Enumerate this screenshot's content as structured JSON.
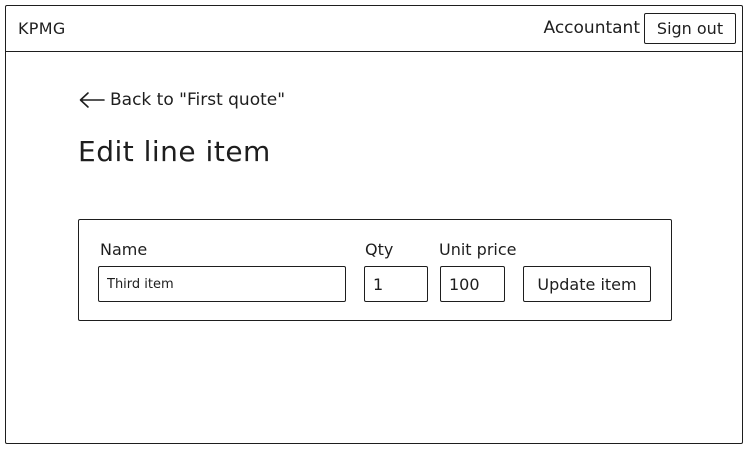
{
  "header": {
    "brand": "KPMG",
    "user_name": "Accountant",
    "sign_out_label": "Sign out"
  },
  "nav": {
    "back_label": "Back to \"First quote\"",
    "back_icon": "arrow-left-icon"
  },
  "page": {
    "title": "Edit line item"
  },
  "form": {
    "name_label": "Name",
    "name_value": "Third item",
    "qty_label": "Qty",
    "qty_value": "1",
    "unit_price_label": "Unit price",
    "unit_price_value": "100",
    "submit_label": "Update item"
  }
}
